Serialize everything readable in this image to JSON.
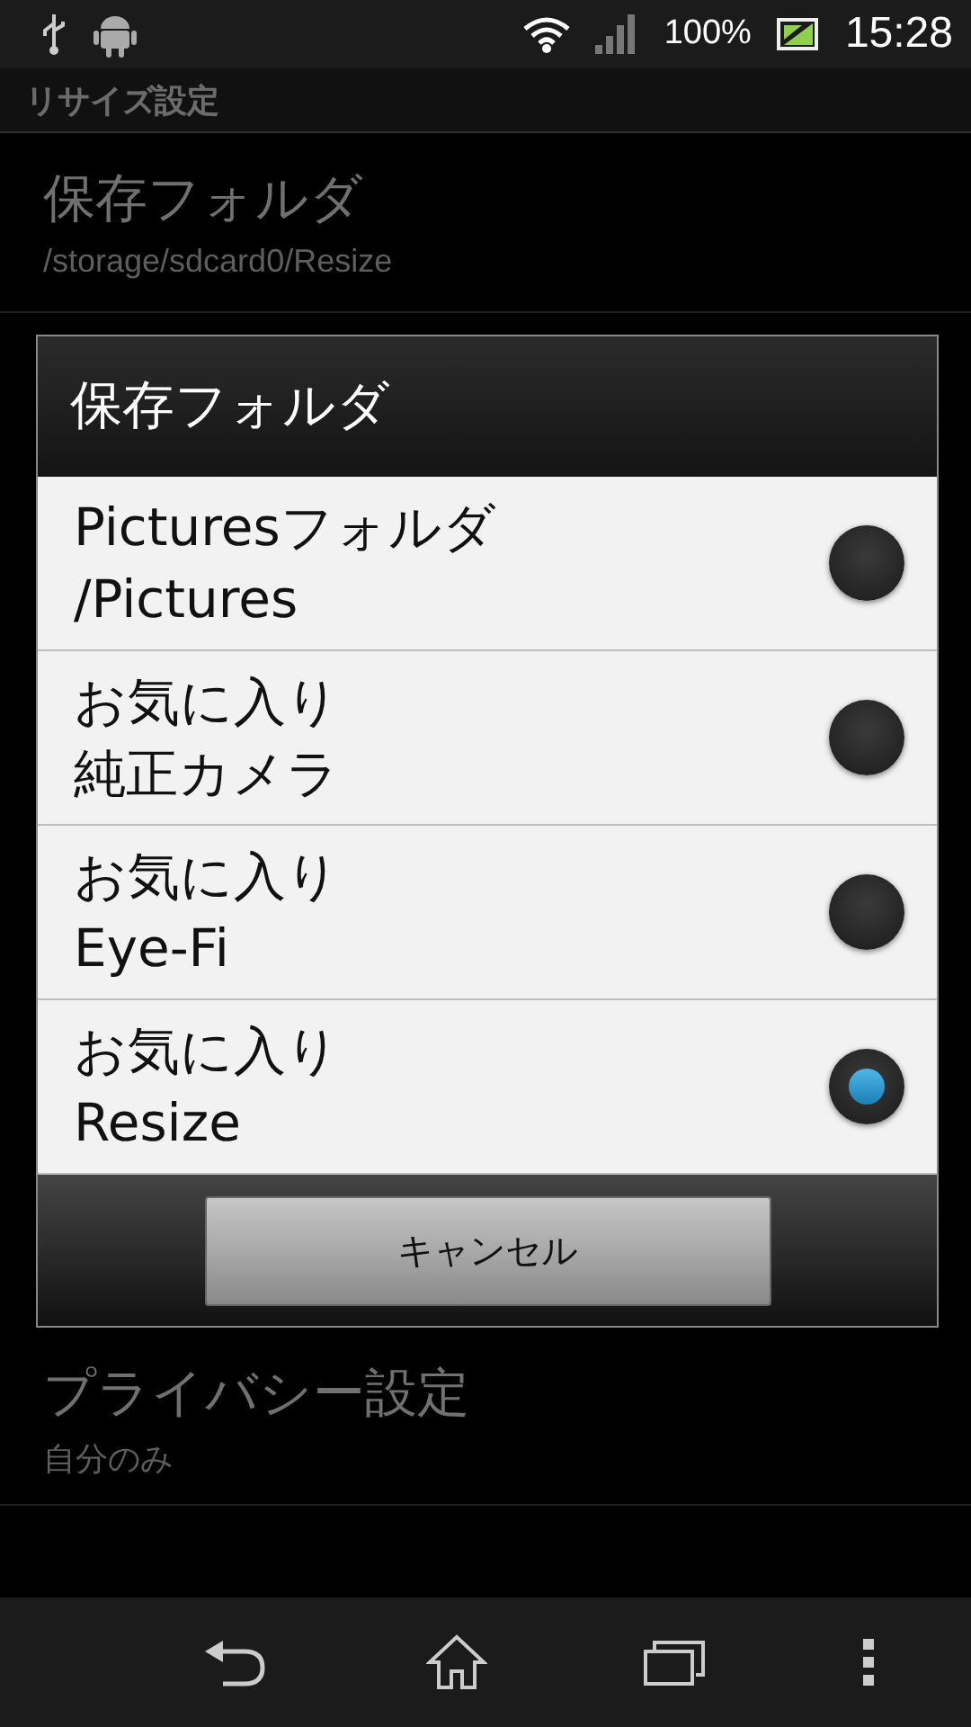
{
  "status_bar": {
    "battery": "100%",
    "time": "15:28"
  },
  "section_header": {
    "label": "リサイズ設定"
  },
  "settings": [
    {
      "title": "保存フォルダ",
      "summary": "/storage/sdcard0/Resize"
    },
    {
      "title": "プライバシー設定",
      "summary": "自分のみ"
    }
  ],
  "dialog": {
    "title": "保存フォルダ",
    "options": [
      {
        "line1": "Picturesフォルダ",
        "line2": "/Pictures",
        "selected": false
      },
      {
        "line1": "お気に入り",
        "line2": "純正カメラ",
        "selected": false
      },
      {
        "line1": "お気に入り",
        "line2": "Eye-Fi",
        "selected": false
      },
      {
        "line1": "お気に入り",
        "line2": "Resize",
        "selected": true
      }
    ],
    "cancel_button": "キャンセル"
  }
}
